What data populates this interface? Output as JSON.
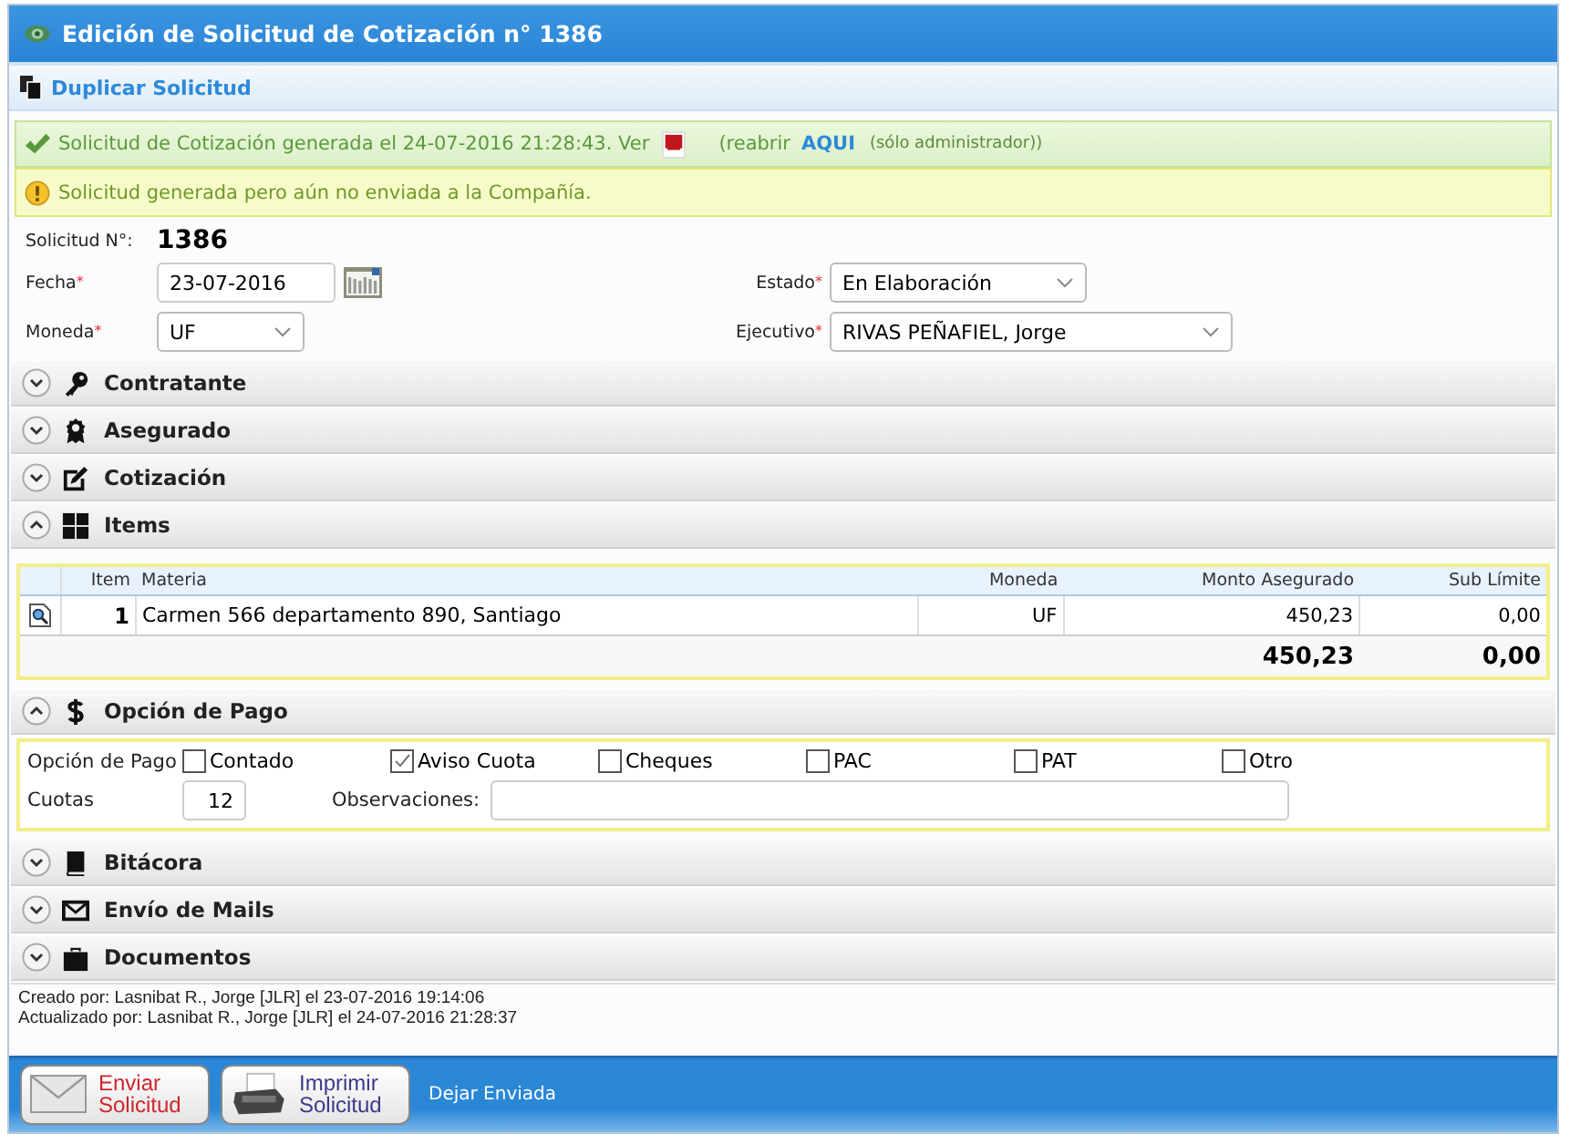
{
  "window": {
    "title": "Edición de Solicitud de Cotización n° 1386"
  },
  "toolbar": {
    "duplicate": "Duplicar Solicitud"
  },
  "messages": [
    {
      "kind": "success",
      "text": "Solicitud de Cotización generada el 24-07-2016 21:28:43. Ver",
      "reopen": "(reabrir",
      "link": "AQUI",
      "note": "(sólo administrador))"
    },
    {
      "kind": "warning",
      "text": "Solicitud generada pero aún no enviada a la Compañía."
    }
  ],
  "form": {
    "number_label": "Solicitud N°:",
    "number": "1386",
    "fields": [
      {
        "kind": "date",
        "label": "Fecha",
        "required_mark": "*",
        "value": "23-07-2016"
      },
      {
        "kind": "select",
        "label": "Estado",
        "required_mark": "*",
        "value": "En Elaboración"
      },
      {
        "kind": "select",
        "label": "Moneda",
        "required_mark": "*",
        "value": "UF"
      },
      {
        "kind": "select",
        "label": "Ejecutivo",
        "required_mark": "*",
        "value": "RIVAS PEÑAFIEL, Jorge"
      }
    ]
  },
  "sections": [
    {
      "title": "Contratante",
      "kind": "key",
      "expanded": false
    },
    {
      "title": "Asegurado",
      "kind": "award",
      "expanded": false
    },
    {
      "title": "Cotización",
      "kind": "edit",
      "expanded": false
    },
    {
      "title": "Items",
      "kind": "items",
      "expanded": true
    },
    {
      "title": "Opción de Pago",
      "kind": "payment",
      "expanded": true
    },
    {
      "title": "Bitácora",
      "kind": "book",
      "expanded": false
    },
    {
      "title": "Envío de Mails",
      "kind": "mail",
      "expanded": false
    },
    {
      "title": "Documentos",
      "kind": "briefcase",
      "expanded": false
    }
  ],
  "items_table": {
    "columns": [
      "Item",
      "Materia",
      "Moneda",
      "Monto Asegurado",
      "Sub Límite"
    ],
    "rows": [
      {
        "item": "1",
        "materia": "Carmen 566 departamento 890, Santiago",
        "moneda": "UF",
        "monto": "450,23",
        "sub_limite": "0,00"
      }
    ],
    "totals": {
      "monto": "450,23",
      "sub_limite": "0,00"
    }
  },
  "payment": {
    "label": "Opción de Pago",
    "options": [
      {
        "label": "Contado",
        "checked": false
      },
      {
        "label": "Aviso Cuota",
        "checked": true
      },
      {
        "label": "Cheques",
        "checked": false
      },
      {
        "label": "PAC",
        "checked": false
      },
      {
        "label": "PAT",
        "checked": false
      },
      {
        "label": "Otro",
        "checked": false
      }
    ],
    "cuotas_label": "Cuotas",
    "cuotas": "12",
    "observaciones_label": "Observaciones:"
  },
  "audit": [
    "Creado por: Lasnibat R., Jorge [JLR] el 23-07-2016 19:14:06",
    "Actualizado por: Lasnibat R., Jorge [JLR] el 24-07-2016 21:28:37"
  ],
  "footer": {
    "buttons": [
      {
        "kind": "send",
        "label": "Enviar Solicitud"
      },
      {
        "kind": "print",
        "label": "Imprimir Solicitud"
      }
    ],
    "link": "Dejar Enviada"
  }
}
